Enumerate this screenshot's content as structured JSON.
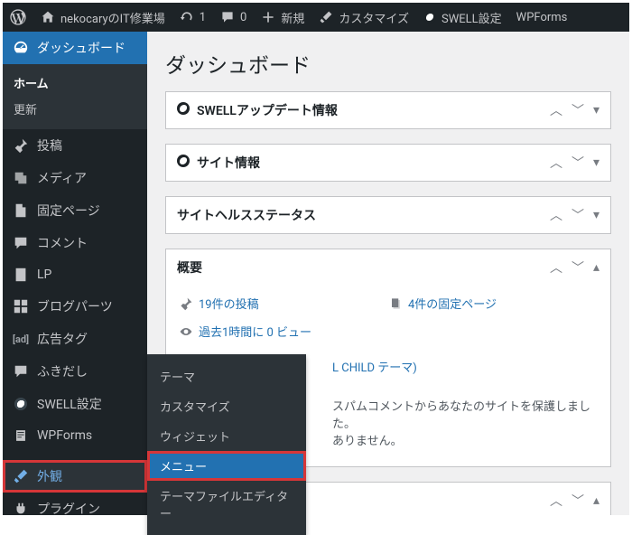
{
  "adminbar": {
    "site_name": "nekocaryのIT修業場",
    "updates": "1",
    "comments": "0",
    "new": "新規",
    "customize": "カスタマイズ",
    "swell": "SWELL設定",
    "wpforms": "WPForms"
  },
  "sidebar": {
    "dashboard": "ダッシュボード",
    "home": "ホーム",
    "updates": "更新",
    "posts": "投稿",
    "media": "メディア",
    "pages": "固定ページ",
    "comments": "コメント",
    "lp": "LP",
    "blogparts": "ブログパーツ",
    "adtag": "広告タグ",
    "fukidashi": "ふきだし",
    "swell": "SWELL設定",
    "wpforms": "WPForms",
    "appearance": "外観",
    "plugins": "プラグイン"
  },
  "flyout": {
    "themes": "テーマ",
    "customize": "カスタマイズ",
    "widgets": "ウィジェット",
    "menus": "メニュー",
    "editor": "テーマファイルエディター"
  },
  "page": {
    "title": "ダッシュボード"
  },
  "boxes": {
    "swell_update": {
      "title": "SWELLアップデート情報"
    },
    "site_info": {
      "title": "サイト情報"
    },
    "health": {
      "title": "サイトヘルスステータス"
    },
    "glance": {
      "title": "概要",
      "posts": "19件の投稿",
      "pages": "4件の固定ページ",
      "views": "過去1時間に 0 ビュー",
      "theme_tail": "L CHILD テーマ)",
      "spam1": "スパムコメントからあなたのサイトを保護しました。",
      "spam2": "ありません。"
    }
  }
}
